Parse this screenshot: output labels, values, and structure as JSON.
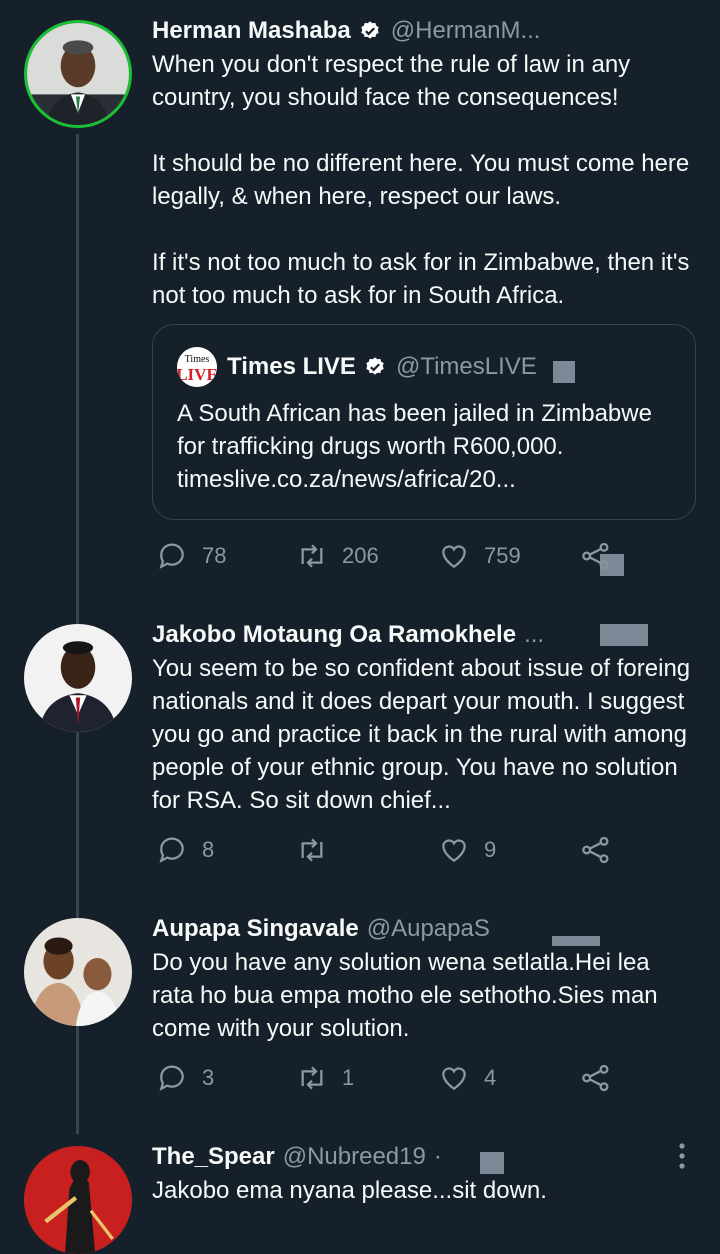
{
  "colors": {
    "background": "#15202b",
    "text": "#f7f9f9",
    "muted": "#8b98a5",
    "border": "#38444d",
    "verified": "#ffffff"
  },
  "tweets": [
    {
      "name": "Herman Mashaba",
      "handle": "@HermanM...",
      "verified": true,
      "avatar_icon": "person-photo-avatar",
      "paragraphs": [
        "When you don't respect the rule of law in any country, you should face the consequences!",
        "It should be no different here. You must come here legally, & when here, respect our laws.",
        "If it's not too much to ask for in Zimbabwe, then it's not too much to ask for in South Africa."
      ],
      "quote": {
        "logo_text_top": "Times",
        "logo_text_bottom": "LIVE",
        "name": "Times LIVE",
        "handle": "@TimesLIVE",
        "text": "A South African has been jailed in Zimbabwe for trafficking drugs worth R600,000. timeslive.co.za/news/africa/20..."
      },
      "replies": "78",
      "retweets": "206",
      "likes": "759"
    },
    {
      "name": "Jakobo Motaung Oa Ramokhele",
      "ellipsis": "...",
      "avatar_icon": "person-photo-avatar",
      "paragraphs": [
        "You seem to be so confident about issue of foreing nationals and it does depart your mouth. I suggest you go and practice it back in the rural with among people of your ethnic group. You have no solution for RSA. So sit down chief..."
      ],
      "replies": "8",
      "retweets": "",
      "likes": "9"
    },
    {
      "name": "Aupapa Singavale",
      "handle": "@AupapaS",
      "avatar_icon": "person-photo-avatar",
      "paragraphs": [
        "Do you have any solution wena setlatla.Hei lea rata ho bua empa motho ele sethotho.Sies man come with your solution."
      ],
      "replies": "3",
      "retweets": "1",
      "likes": "4"
    },
    {
      "name": "The_Spear",
      "handle": "@Nubreed19",
      "dot": "·",
      "avatar_icon": "artwork-avatar",
      "paragraphs": [
        "Jakobo ema nyana please...sit down."
      ]
    }
  ]
}
